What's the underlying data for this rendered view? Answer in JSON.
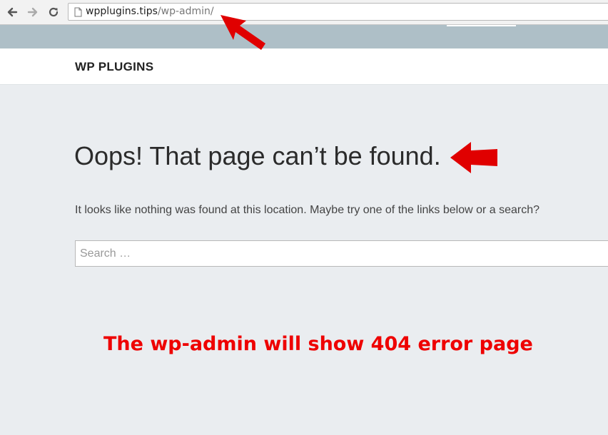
{
  "browser": {
    "url_domain": "wpplugins.tips",
    "url_path": "/wp-admin/",
    "icons": [
      "back-icon",
      "forward-icon",
      "reload-icon",
      "page-icon"
    ]
  },
  "site": {
    "title": "WP PLUGINS"
  },
  "content": {
    "headline": "Oops! That page can’t be found.",
    "message": "It looks like nothing was found at this location. Maybe try one of the links below or a search?",
    "search_placeholder": "Search …"
  },
  "annotation": {
    "text": "The wp-admin will show 404 error page",
    "color": "#ee0000"
  },
  "colors": {
    "page_background": "#eaedf0",
    "top_band": "#aebfc7",
    "arrow": "#e00000"
  }
}
